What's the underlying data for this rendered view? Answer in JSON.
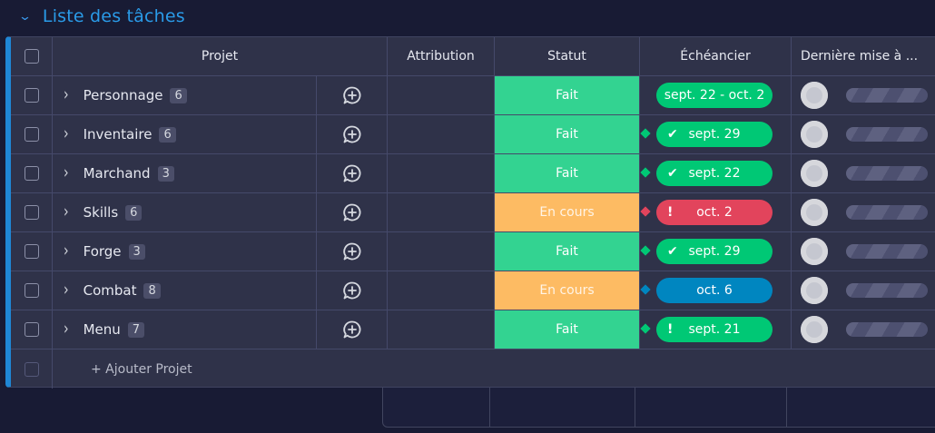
{
  "group": {
    "title": "Liste des tâches",
    "accent": "#2a9be8"
  },
  "headers": {
    "projet": "Projet",
    "attribution": "Attribution",
    "statut": "Statut",
    "echeancier": "Échéancier",
    "derniere": "Dernière mise à ..."
  },
  "rows": [
    {
      "name": "Personnage",
      "count": "6",
      "status": "Fait",
      "status_type": "done",
      "timeline": "sept. 22 - oct. 2",
      "timeline_color": "green",
      "timeline_icon": "",
      "diamond": ""
    },
    {
      "name": "Inventaire",
      "count": "6",
      "status": "Fait",
      "status_type": "done",
      "timeline": "sept. 29",
      "timeline_color": "green",
      "timeline_icon": "check",
      "diamond": "#00c875"
    },
    {
      "name": "Marchand",
      "count": "3",
      "status": "Fait",
      "status_type": "done",
      "timeline": "sept. 22",
      "timeline_color": "green",
      "timeline_icon": "check",
      "diamond": "#00c875"
    },
    {
      "name": "Skills",
      "count": "6",
      "status": "En cours",
      "status_type": "wip",
      "timeline": "oct. 2",
      "timeline_color": "red",
      "timeline_icon": "alert",
      "diamond": "#e2445c"
    },
    {
      "name": "Forge",
      "count": "3",
      "status": "Fait",
      "status_type": "done",
      "timeline": "sept. 29",
      "timeline_color": "green",
      "timeline_icon": "check",
      "diamond": "#00c875"
    },
    {
      "name": "Combat",
      "count": "8",
      "status": "En cours",
      "status_type": "wip",
      "timeline": "oct. 6",
      "timeline_color": "blue",
      "timeline_icon": "",
      "diamond": "#0086c0"
    },
    {
      "name": "Menu",
      "count": "7",
      "status": "Fait",
      "status_type": "done",
      "timeline": "sept. 21",
      "timeline_color": "green",
      "timeline_icon": "alert",
      "diamond": "#00c875"
    }
  ],
  "add_row": {
    "label": "+ Ajouter Projet"
  },
  "icons": {
    "chevron": "chevron-down-icon",
    "expand": "chevron-right-icon",
    "update": "add-update-icon"
  },
  "colors": {
    "done": "#33d391",
    "wip": "#fdbb63",
    "accent_border": "#1f87d6"
  }
}
